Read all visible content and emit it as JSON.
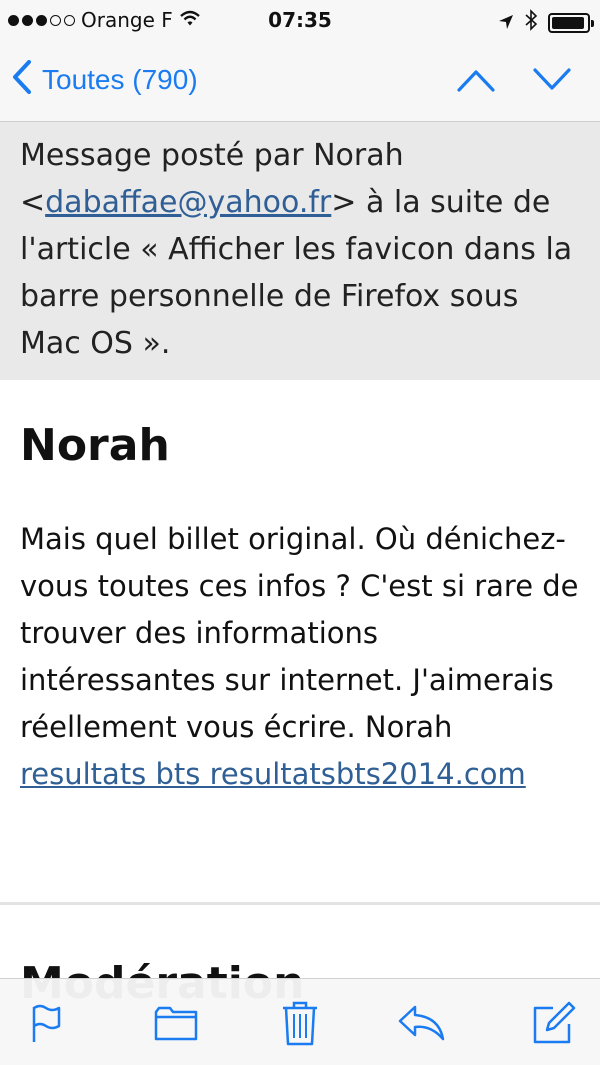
{
  "status_bar": {
    "carrier": "Orange F",
    "time": "07:35",
    "signal_bars_filled": 3,
    "signal_bars_total": 5,
    "battery_level": 0.95,
    "icons": [
      "wifi-icon",
      "location-icon",
      "bluetooth-icon",
      "battery-icon"
    ]
  },
  "nav": {
    "back_label": "Toutes (790)",
    "up_icon": "chevron-up-icon",
    "down_icon": "chevron-down-icon",
    "accent_color": "#1a7cf0"
  },
  "banner": {
    "prefix": "Message posté par Norah <",
    "email": "dabaffae@yahoo.fr",
    "suffix": "> à la suite de l'article « Afficher les favicon dans la barre personnelle de Firefox sous Mac OS »."
  },
  "comment": {
    "author": "Norah",
    "text": "Mais quel billet original. Où dénichez-vous toutes ces infos ? C'est si rare de trouver des informations intéressantes sur internet. J'aimerais réellement vous écrire. Norah ",
    "link_text": "resultats bts resultatsbts2014.com"
  },
  "next_section": {
    "heading": "Modération"
  },
  "toolbar": {
    "items": [
      "flag-icon",
      "folder-icon",
      "trash-icon",
      "reply-icon",
      "compose-icon"
    ]
  }
}
